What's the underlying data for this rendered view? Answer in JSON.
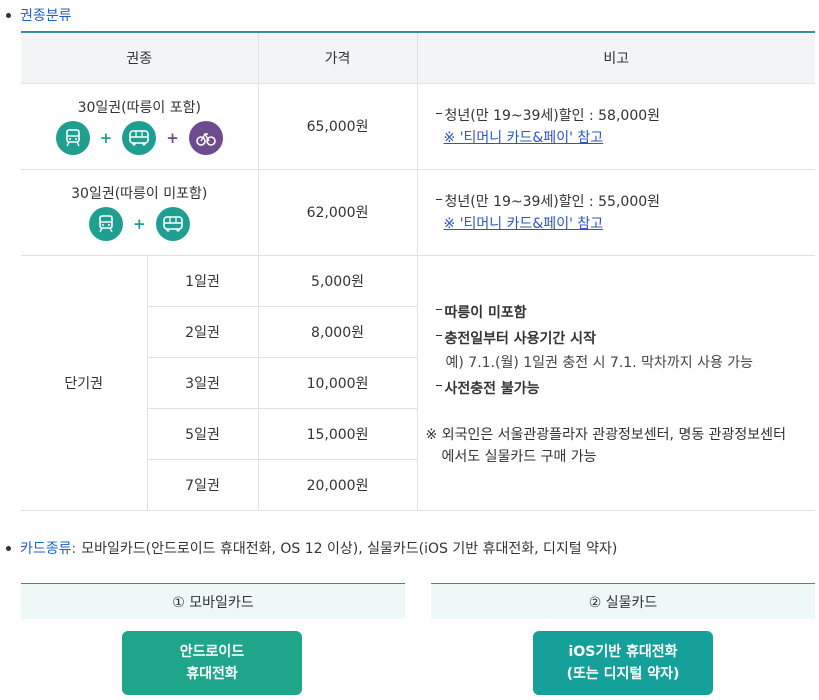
{
  "section1": {
    "title": "권종분류"
  },
  "table": {
    "headers": [
      "권종",
      "가격",
      "비고"
    ],
    "row30_incl": {
      "name": "30일권(따릉이 포함)",
      "price": "65,000원",
      "note": "청년(만 19~39세)할인 : 58,000원",
      "link": "※ '티머니 카드&페이' 참고"
    },
    "row30_excl": {
      "name": "30일권(따릉이 미포함)",
      "price": "62,000원",
      "note": "청년(만 19~39세)할인 : 55,000원",
      "link": "※ '티머니 카드&페이' 참고"
    },
    "short": {
      "group": "단기권",
      "items": [
        {
          "label": "1일권",
          "price": "5,000원"
        },
        {
          "label": "2일권",
          "price": "8,000원"
        },
        {
          "label": "3일권",
          "price": "10,000원"
        },
        {
          "label": "5일권",
          "price": "15,000원"
        },
        {
          "label": "7일권",
          "price": "20,000원"
        }
      ],
      "notes": {
        "n1": "따릉이 미포함",
        "n2": "충전일부터 사용기간 시작",
        "n2_sub": "예) 7.1.(월) 1일권 충전 시 7.1. 막차까지 사용 가능",
        "n3": "사전충전 불가능",
        "foreign1": "※ 외국인은 서울관광플라자 관광정보센터, 명동 관광정보센터",
        "foreign2": "에서도 실물카드 구매 가능"
      }
    },
    "icons": [
      "subway-icon",
      "bus-icon",
      "bike-icon"
    ],
    "plus": "+"
  },
  "cards": {
    "label": "카드종류:",
    "text": "모바일카드(안드로이드 휴대전화, OS 12 이상), 실물카드(iOS 기반 휴대전화, 디지털 약자)",
    "mobile": {
      "title": "① 모바일카드",
      "btn1": "안드로이드",
      "btn2": "휴대전화"
    },
    "physical": {
      "title": "② 실물카드",
      "btn1": "iOS기반 휴대전화",
      "btn2": "(또는 디지털 약자)"
    }
  },
  "colors": {
    "teal": "#1f9f91",
    "purple": "#6d4b8e",
    "header_line": "#3b8da0",
    "link": "#2c55c8"
  }
}
